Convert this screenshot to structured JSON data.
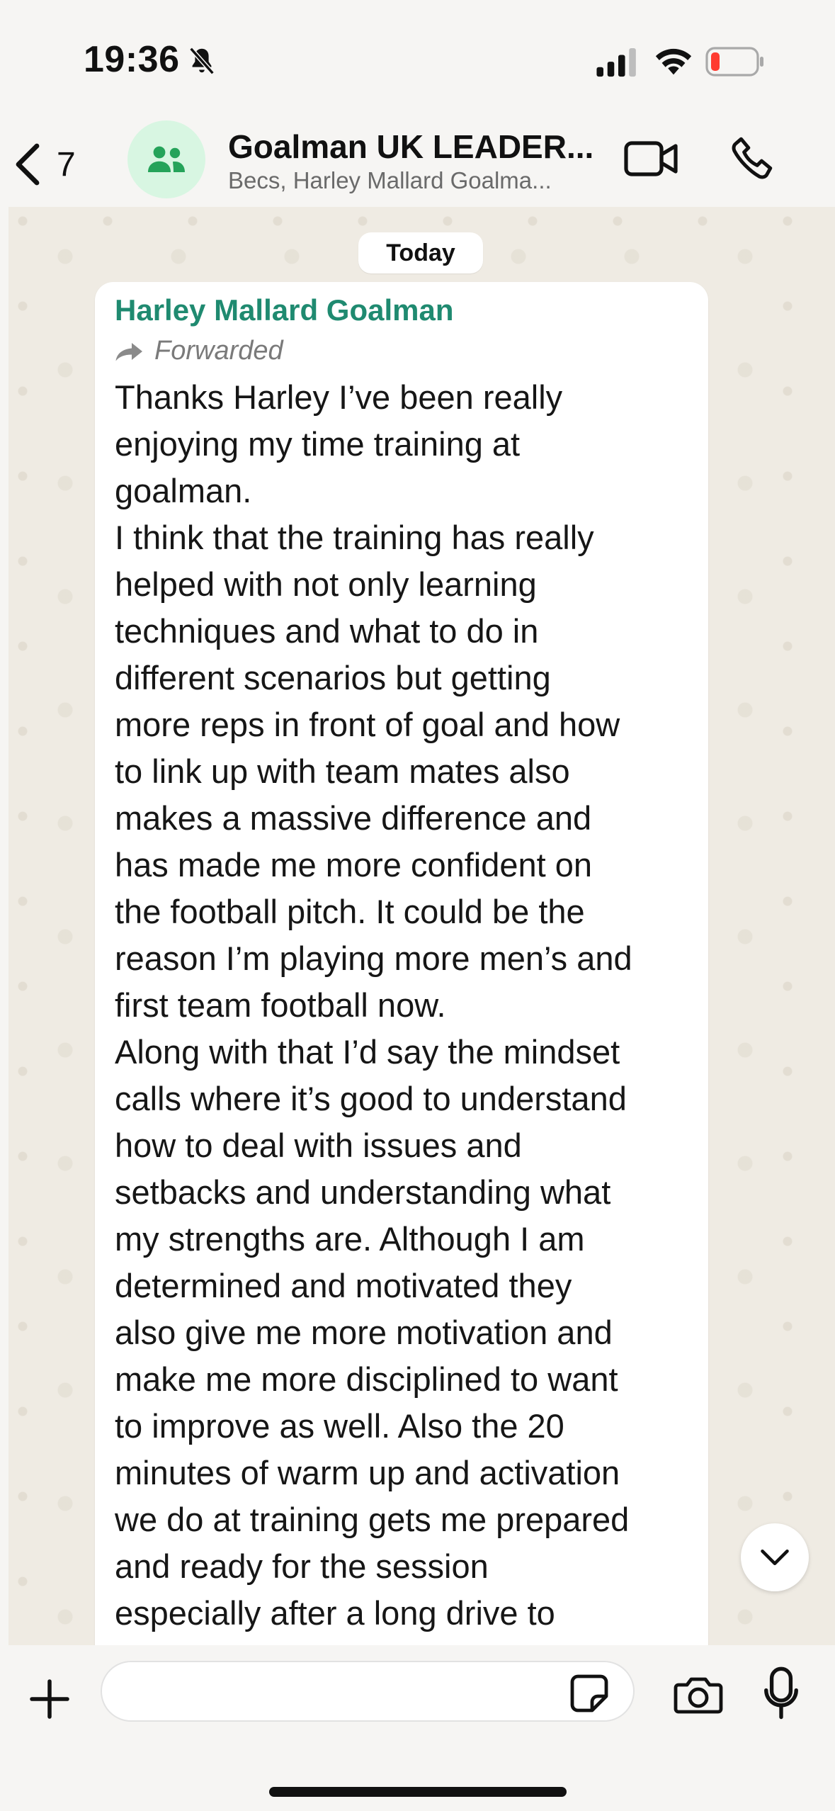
{
  "status_bar": {
    "time": "19:36",
    "icons": [
      "bell-slash-icon",
      "cellular-signal-icon",
      "wifi-icon",
      "battery-low-icon"
    ]
  },
  "header": {
    "back_count": "7",
    "title": "Goalman UK LEADER...",
    "subtitle": "Becs, Harley Mallard Goalma...",
    "avatar_icon": "group-icon",
    "accent_color": "#25a35a"
  },
  "chat": {
    "date_label": "Today",
    "message": {
      "sender": "Harley Mallard Goalman",
      "sender_color": "#1f8a70",
      "forwarded_label": "Forwarded",
      "text": "Thanks Harley I’ve been really\nenjoying my time training at\ngoalman.\nI think that the training has really\nhelped with not only learning\ntechniques and what to do in\ndifferent scenarios but getting\nmore reps in front of goal and how\nto link up with team mates also\nmakes a massive difference and\nhas made me more confident on\nthe football pitch. It could be the\nreason I’m playing more men’s and\nfirst team football now.\nAlong with that I’d say the mindset\ncalls where it’s good to understand\nhow to deal with issues and\nsetbacks and understanding what\nmy strengths are. Although I am\ndetermined and motivated they\nalso give me more motivation and\nmake me more disciplined to want\nto improve as well. Also the 20\nminutes of warm up and activation\nwe do at training gets me prepared\nand ready for the session\nespecially after a long drive to"
    }
  },
  "input_bar": {
    "value": "",
    "placeholder": ""
  }
}
